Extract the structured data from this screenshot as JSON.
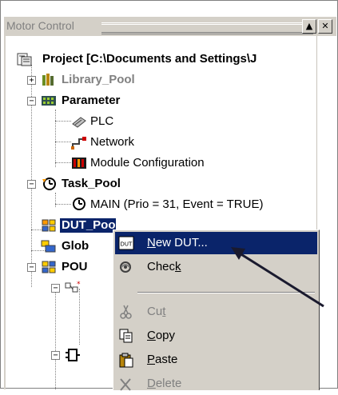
{
  "window": {
    "title": "Motor Control",
    "minimize_glyph": "▲",
    "close_glyph": "✕"
  },
  "tree": {
    "project": "Project [C:\\Documents and Settings\\J",
    "library_pool": "Library_Pool",
    "parameter": "Parameter",
    "plc": "PLC",
    "network": "Network",
    "module_configuration": "Module Configuration",
    "task_pool": "Task_Pool",
    "main_task": "MAIN (Prio = 31, Event = TRUE)",
    "dut_pool": "DUT_Pool",
    "global": "Glob",
    "pou": "POU"
  },
  "context_menu": {
    "new_dut": {
      "pre": "",
      "key": "N",
      "post": "ew DUT..."
    },
    "check": {
      "pre": "Chec",
      "key": "k",
      "post": ""
    },
    "cut": {
      "pre": "Cu",
      "key": "t",
      "post": ""
    },
    "copy": {
      "pre": "",
      "key": "C",
      "post": "opy"
    },
    "paste": {
      "pre": "",
      "key": "P",
      "post": "aste"
    },
    "delete": {
      "pre": "",
      "key": "D",
      "post": "elete"
    },
    "new_dut_icon_text": "DUT"
  },
  "colors": {
    "selection": "#0a246a",
    "menu_bg": "#d4d0c8",
    "disabled": "#808080",
    "arrow": "#1a1a2e"
  }
}
